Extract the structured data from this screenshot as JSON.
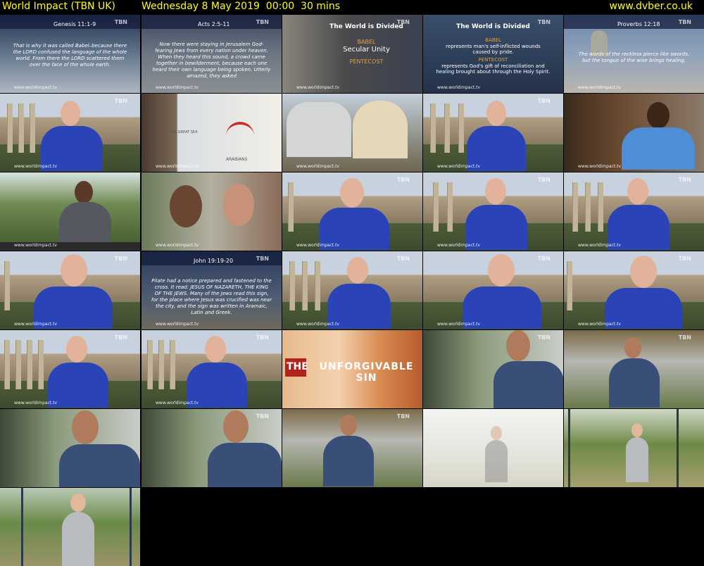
{
  "header": {
    "title": "World Impact (TBN UK)",
    "datetime": "Wednesday 8 May 2019  00:00  30 mins",
    "site": "www.dvber.co.uk"
  },
  "watermark": "www.worldimpact.tv",
  "channel_logo": "TBN",
  "scripture_refs": {
    "r1": "Genesis 11:1-9",
    "r2": "Acts 2:5-11",
    "r5": "Proverbs 12:18",
    "r17": "John 19:19-20"
  },
  "scripture_texts": {
    "t1": "That is why it was called Babel–because there the LORD confused the language of the whole world. From there the LORD scattered them over the face of the whole earth.",
    "t2": "Now there were staying in Jerusalem God-fearing Jews from every nation under heaven. When they heard this sound, a crowd came together in bewilderment, because each one heard their own language being spoken. Utterly amazed, they asked",
    "t5": "The words of the reckless pierce like swords, but the tongue of the wise brings healing.",
    "t17": "Pilate had a notice prepared and fastened to the cross. It read: JESUS OF NAZARETH, THE KING OF THE JEWS. Many of the Jews read this sign, for the place where Jesus was crucified was near the city, and the sign was written in Aramaic, Latin and Greek."
  },
  "slide3": {
    "heading": "The World is Divided",
    "babel": "BABEL",
    "unity": "Secular Unity",
    "pentecost": "PENTECOST"
  },
  "slide4": {
    "heading": "The World is Divided",
    "babel": "BABEL",
    "babel_text": "represents man's self-inflicted wounds caused by pride.",
    "pentecost": "PENTECOST",
    "pentecost_text": "represents God's gift of reconciliation and healing brought about through the Holy Spirit."
  },
  "map_labels": {
    "sea": "THE GREAT SEA",
    "region": "ARABIANS"
  },
  "title_card": {
    "the": "THE",
    "main": "UNFORGIVABLE SIN"
  },
  "colors": {
    "header_text": "#ffff00",
    "background": "#000000",
    "shirt": "#2a44b8"
  }
}
